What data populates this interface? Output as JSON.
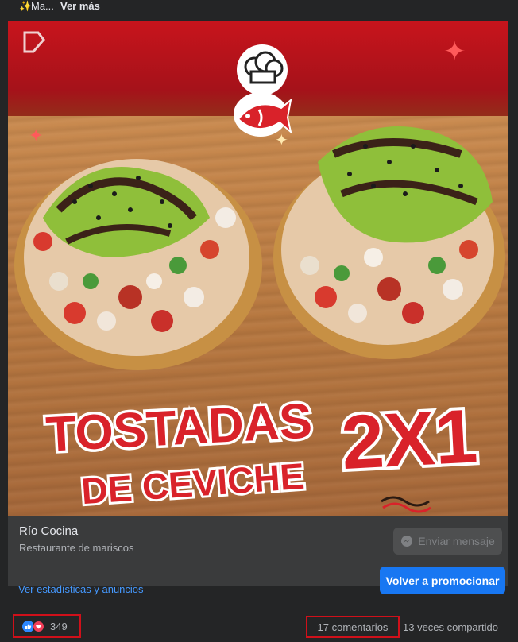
{
  "post": {
    "sparkle_icon": "sparkles-icon",
    "text_truncated": "Ma...",
    "see_more": "Ver más"
  },
  "media": {
    "headline_line1": "TOSTADAS",
    "headline_line2": "DE CEVICHE",
    "promo_text": "2X1",
    "colors": {
      "text_red": "#d9222a",
      "outline": "#ffffff",
      "bg_red": "#c8141c"
    }
  },
  "page": {
    "name": "Río Cocina",
    "category": "Restaurante de mariscos",
    "message_button": "Enviar mensaje",
    "message_icon": "messenger-icon"
  },
  "actions": {
    "stats_link": "Ver estadísticas y anuncios",
    "promote_button": "Volver a promocionar"
  },
  "engagement": {
    "reaction_icons": [
      "like-icon",
      "love-icon"
    ],
    "reactions_count": "349",
    "comments": "17 comentarios",
    "shares": "13 veces compartido"
  },
  "colors": {
    "accent_blue": "#1877f2",
    "link_blue": "#4599ff",
    "highlight_red": "#d0101a",
    "bg": "#242526"
  }
}
